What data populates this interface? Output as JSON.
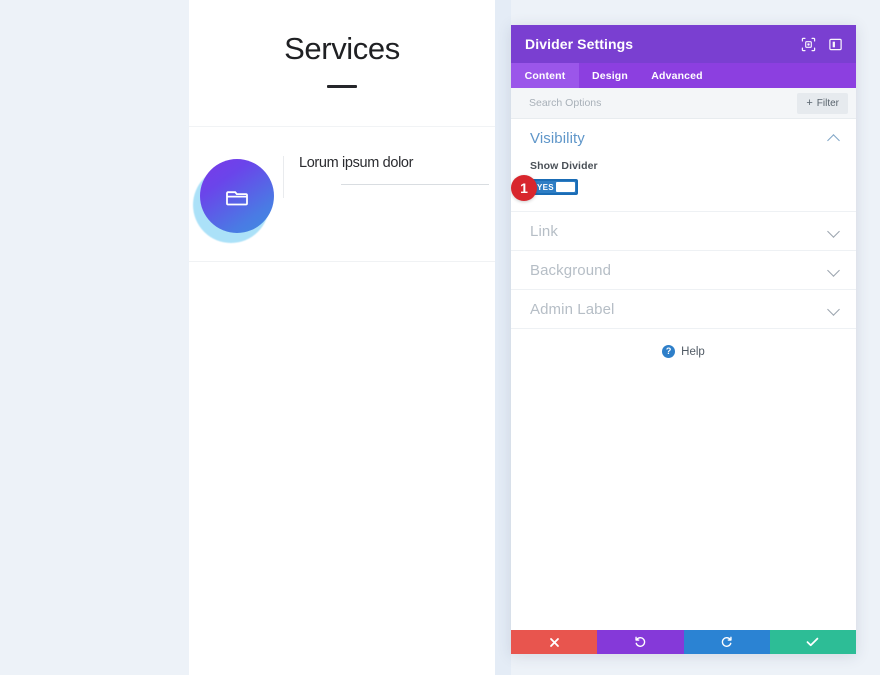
{
  "preview": {
    "hero_title": "Services",
    "card": {
      "title": "Lorum ipsum dolor",
      "icon": "folder-icon"
    }
  },
  "panel": {
    "title": "Divider Settings",
    "header_icons": [
      {
        "name": "focus-target-icon"
      },
      {
        "name": "panel-layout-icon"
      }
    ],
    "tabs": [
      {
        "label": "Content",
        "active": true
      },
      {
        "label": "Design",
        "active": false
      },
      {
        "label": "Advanced",
        "active": false
      }
    ],
    "search": {
      "placeholder": "Search Options",
      "value": ""
    },
    "filter_label": "Filter",
    "filter_plus": "+",
    "sections": [
      {
        "label": "Visibility",
        "expanded": true
      },
      {
        "label": "Link",
        "expanded": false
      },
      {
        "label": "Background",
        "expanded": false
      },
      {
        "label": "Admin Label",
        "expanded": false
      }
    ],
    "visibility": {
      "field_label": "Show Divider",
      "toggle_value": "YES",
      "step_badge": "1"
    },
    "help_label": "Help",
    "help_icon_glyph": "?",
    "footer_buttons": [
      {
        "name": "cancel-button",
        "icon": "close-icon"
      },
      {
        "name": "undo-button",
        "icon": "undo-icon"
      },
      {
        "name": "redo-button",
        "icon": "redo-icon"
      },
      {
        "name": "save-button",
        "icon": "check-icon"
      }
    ]
  },
  "colors": {
    "header_purple": "#7a3fd1",
    "tabs_purple": "#8c3fe0",
    "tab_active": "#9b56ea",
    "accent_blue": "#2d7dc4",
    "badge_red": "#d8262d",
    "cancel_red": "#e8554e",
    "undo_purple": "#8539d9",
    "redo_blue": "#2b83d3",
    "save_green": "#2dbd96",
    "page_bg": "#edf2f8"
  }
}
